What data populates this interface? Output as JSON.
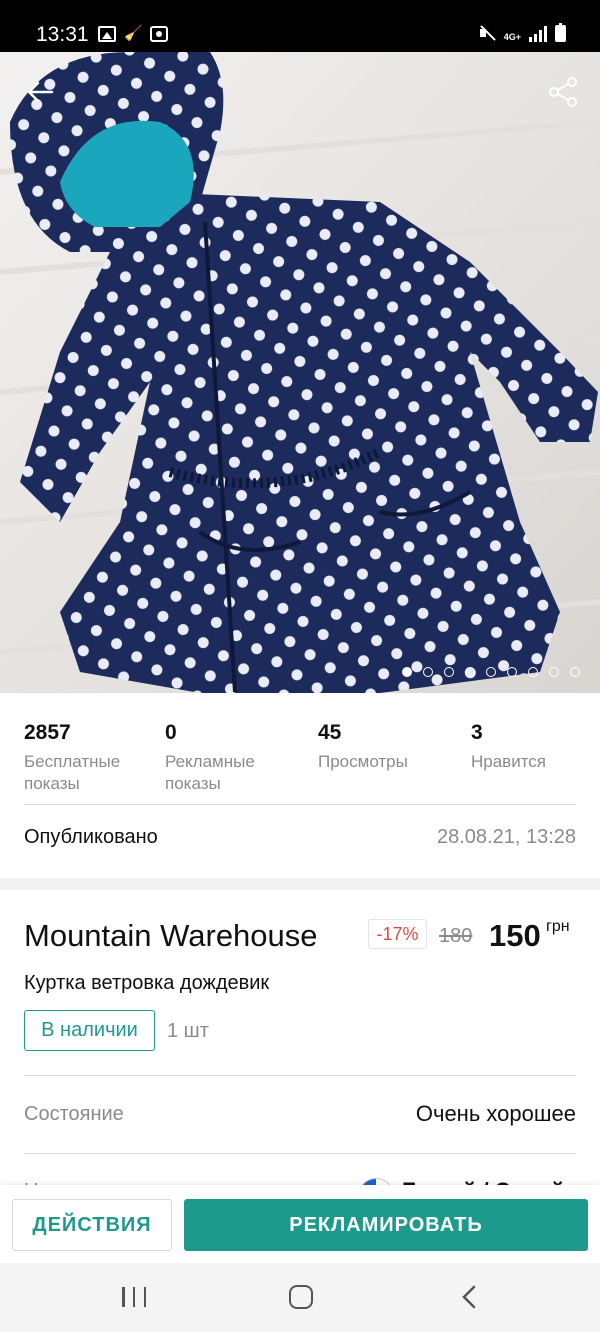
{
  "status_bar": {
    "time": "13:31",
    "network": "4G+",
    "left_icons": [
      "image-icon",
      "broom-icon",
      "screen-record-icon"
    ],
    "right_icons": [
      "mute-icon",
      "network-icon",
      "signal-icon",
      "battery-icon"
    ]
  },
  "photo": {
    "description_icon": "polka-dot-jacket-photo",
    "page_count": 9,
    "current_page": 1
  },
  "header": {
    "back_icon": "arrow-left-icon",
    "share_icon": "share-icon"
  },
  "stats": [
    {
      "value": "2857",
      "label": "Бесплатные показы"
    },
    {
      "value": "0",
      "label": "Рекламные показы"
    },
    {
      "value": "45",
      "label": "Просмотры"
    },
    {
      "value": "3",
      "label": "Нравится"
    }
  ],
  "published": {
    "label": "Опубликовано",
    "date": "28.08.21, 13:28"
  },
  "listing": {
    "brand": "Mountain Warehouse",
    "discount": "-17%",
    "old_price": "180",
    "price": "150",
    "currency": "грн",
    "title": "Куртка ветровка дождевик",
    "stock_status": "В наличии",
    "quantity": "1 шт"
  },
  "details": {
    "condition_label": "Состояние",
    "condition_value": "Очень хорошее",
    "color_label": "Цвет",
    "color_value": "Белый / Синий"
  },
  "actions": {
    "actions_label": "ДЕЙСТВИЯ",
    "promote_label": "РЕКЛАМИРОВАТЬ"
  },
  "colors": {
    "accent": "#1e9a8d",
    "discount": "#e24b3b",
    "muted_text": "#8b8b8b",
    "jacket": "#1c2a5c"
  }
}
